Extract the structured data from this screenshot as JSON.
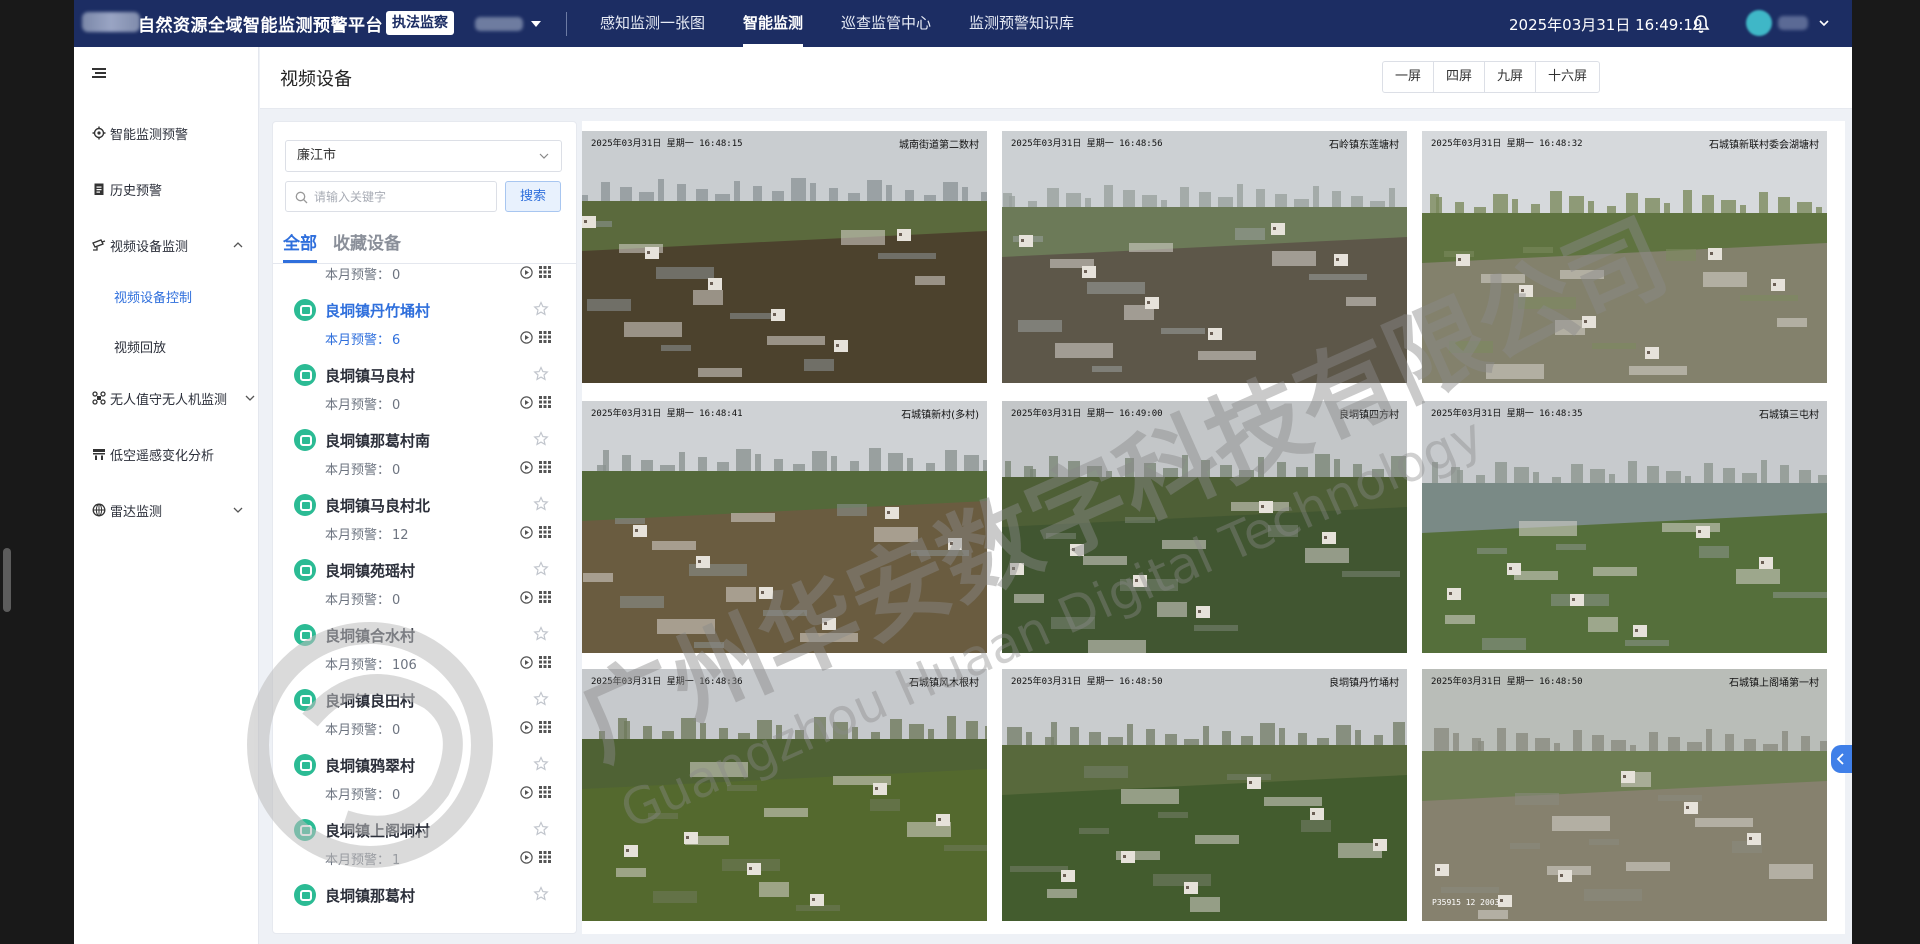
{
  "header": {
    "platform_title": "自然资源全域智能监测预警平台",
    "role_tag": "执法监察",
    "nav": [
      {
        "label": "感知监测一张图",
        "active": false
      },
      {
        "label": "智能监测",
        "active": true
      },
      {
        "label": "巡查监管中心",
        "active": false
      },
      {
        "label": "监测预警知识库",
        "active": false
      }
    ],
    "datetime": "2025年03月31日 16:49:19"
  },
  "sidebar": {
    "items": [
      {
        "label": "智能监测预警",
        "icon": "gear-icon"
      },
      {
        "label": "历史预警",
        "icon": "clipboard-icon"
      },
      {
        "label": "视频设备监测",
        "icon": "camera-icon",
        "expanded": true
      },
      {
        "label": "无人值守无人机监测",
        "icon": "drone-icon",
        "expanded": false
      },
      {
        "label": "低空遥感变化分析",
        "icon": "satellite-icon"
      },
      {
        "label": "雷达监测",
        "icon": "radar-icon",
        "expanded": false
      }
    ],
    "sub_items": [
      {
        "label": "视频设备控制",
        "active": true
      },
      {
        "label": "视频回放",
        "active": false
      }
    ]
  },
  "page": {
    "title": "视频设备",
    "screen_modes": [
      "一屏",
      "四屏",
      "九屏",
      "十六屏"
    ]
  },
  "device_panel": {
    "region": "廉江市",
    "search_placeholder": "请输入关键字",
    "search_label": "搜索",
    "tabs": [
      {
        "label": "全部",
        "active": true
      },
      {
        "label": "收藏设备",
        "active": false
      }
    ],
    "alert_label": "本月预警：",
    "partial_alert_value": "0",
    "devices": [
      {
        "name": "良垌镇丹竹埇村",
        "alerts": "6",
        "active": true
      },
      {
        "name": "良垌镇马良村",
        "alerts": "0"
      },
      {
        "name": "良垌镇那葛村南",
        "alerts": "0"
      },
      {
        "name": "良垌镇马良村北",
        "alerts": "12"
      },
      {
        "name": "良垌镇苑瑶村",
        "alerts": "0"
      },
      {
        "name": "良垌镇合水村",
        "alerts": "106"
      },
      {
        "name": "良垌镇良田村",
        "alerts": "0"
      },
      {
        "name": "良垌镇鸦翠村",
        "alerts": "0"
      },
      {
        "name": "良垌镇上阁垌村",
        "alerts": "1"
      },
      {
        "name": "良垌镇那葛村",
        "alerts": ""
      }
    ]
  },
  "videos": [
    {
      "osd_time": "2025年03月31日 星期一 16:48:15",
      "osd_loc": "城南街道第二数村",
      "colors": {
        "sky": "#c9cdd0",
        "far": "#8e9698",
        "mid": "#5b6a3d",
        "near": "#4a3b2a"
      }
    },
    {
      "osd_time": "2025年03月31日 星期一 16:48:56",
      "osd_loc": "石岭镇东莲塘村",
      "colors": {
        "sky": "#ccd0d3",
        "far": "#9aa19f",
        "mid": "#6c7a58",
        "near": "#5a5147"
      }
    },
    {
      "osd_time": "2025年03月31日 星期一 16:48:32",
      "osd_loc": "石城镇新联村委会湖塘村",
      "colors": {
        "sky": "#d6d9dc",
        "far": "#7c8a5e",
        "mid": "#5f7340",
        "near": "#8a8474"
      }
    },
    {
      "osd_time": "2025年03月31日 星期一 16:48:41",
      "osd_loc": "石城镇新村(多村)",
      "colors": {
        "sky": "#cfd2d5",
        "far": "#8b9391",
        "mid": "#54693a",
        "near": "#6e5b42"
      }
    },
    {
      "osd_time": "2025年03月31日 星期一 16:49:00",
      "osd_loc": "良垌镇四方村",
      "colors": {
        "sky": "#c3c6c8",
        "far": "#7b8677",
        "mid": "#4e5f36",
        "near": "#3f5530"
      }
    },
    {
      "osd_time": "2025年03月31日 星期一 16:48:35",
      "osd_loc": "石城镇三屯村",
      "colors": {
        "sky": "#c7cacd",
        "far": "#8c958e",
        "mid": "#7a8a86",
        "near": "#4f6a2e"
      }
    },
    {
      "osd_time": "2025年03月31日 星期一 16:48:36",
      "osd_loc": "石城镇风木根村",
      "colors": {
        "sky": "#c6c9cc",
        "far": "#6f7a5c",
        "mid": "#4f6234",
        "near": "#556b2e"
      }
    },
    {
      "osd_time": "2025年03月31日 星期一 16:48:50",
      "osd_loc": "良垌镇丹竹埇村",
      "colors": {
        "sky": "#c9ccce",
        "far": "#77806c",
        "mid": "#58693c",
        "near": "#3f5a2c"
      }
    },
    {
      "osd_time": "2025年03月31日 星期一 16:48:50",
      "osd_loc": "石城镇上阁埇第一村",
      "osd_foot": "P35915 12   2003",
      "colors": {
        "sky": "#b9bdb8",
        "far": "#8a8b80",
        "mid": "#6d7d52",
        "near": "#8b8173"
      }
    }
  ],
  "watermark": {
    "text_cn": "广州华安数字科技有限公司",
    "text_en": "Guangzhou Huaan Digital Technology",
    "color": "#8a8a8a"
  },
  "colors": {
    "header_bg": "#1c2d63",
    "accent": "#2f6fdc",
    "device_icon": "#2bbb94"
  }
}
